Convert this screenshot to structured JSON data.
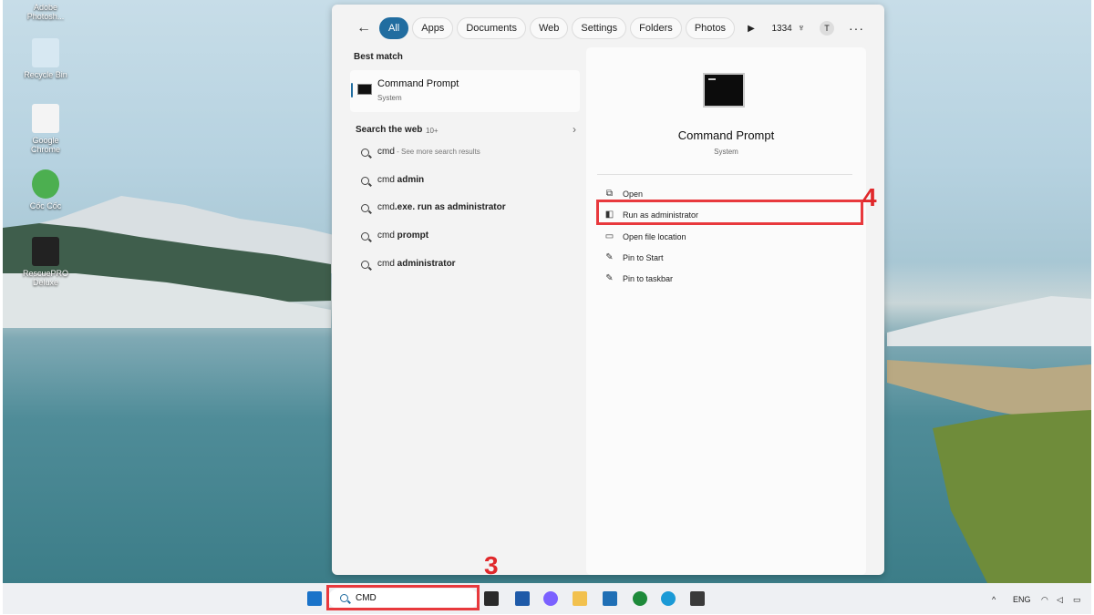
{
  "desktop_icons": [
    {
      "label": "Adobe Photosh...",
      "color": "#1b2a4a"
    },
    {
      "label": "Recycle Bin",
      "color": "#d7e8f2"
    },
    {
      "label": "Google Chrome",
      "color": "#f4f4f4"
    },
    {
      "label": "Cốc Cốc",
      "color": "#4caf50"
    },
    {
      "label": "RescuePRO Deluxe",
      "color": "#222222"
    }
  ],
  "filters": {
    "back": "←",
    "chips": [
      "All",
      "Apps",
      "Documents",
      "Web",
      "Settings",
      "Folders",
      "Photos"
    ],
    "active": "All",
    "play": "▶",
    "points": "1334",
    "avatar": "T",
    "more": "···"
  },
  "best_match": {
    "heading": "Best match",
    "title": "Command Prompt",
    "subtitle": "System"
  },
  "search_web": {
    "heading": "Search the web",
    "count": "10+",
    "chevron": "›",
    "items": [
      {
        "normal": "cmd",
        "bold": "",
        "hint": " - See more search results"
      },
      {
        "normal": "cmd ",
        "bold": "admin",
        "hint": ""
      },
      {
        "normal": "cmd",
        "bold": ".exe. run as administrator",
        "hint": ""
      },
      {
        "normal": "cmd ",
        "bold": "prompt",
        "hint": ""
      },
      {
        "normal": "cmd ",
        "bold": "administrator",
        "hint": ""
      }
    ]
  },
  "details": {
    "title": "Command Prompt",
    "subtitle": "System",
    "actions": [
      {
        "label": "Open",
        "icon": "open-external-icon",
        "glyph": "⧉"
      },
      {
        "label": "Run as administrator",
        "icon": "shield-admin-icon",
        "glyph": "◧"
      },
      {
        "label": "Open file location",
        "icon": "folder-icon",
        "glyph": "▭"
      },
      {
        "label": "Pin to Start",
        "icon": "pin-icon",
        "glyph": "✎"
      },
      {
        "label": "Pin to taskbar",
        "icon": "pin-icon",
        "glyph": "✎"
      }
    ]
  },
  "annotations": {
    "step3": "3",
    "step4": "4",
    "color": "#e8393d"
  },
  "taskbar": {
    "search_value": "CMD",
    "apps": [
      {
        "name": "windows-start-icon",
        "color": "#1a73c9"
      },
      {
        "name": "terminal-icon",
        "color": "#2a2a2a"
      },
      {
        "name": "app-icon",
        "color": "#1e5aa8"
      },
      {
        "name": "copilot-icon",
        "color": "#7b61ff"
      },
      {
        "name": "file-explorer-icon",
        "color": "#f2c14e"
      },
      {
        "name": "store-icon",
        "color": "#1f6fb5"
      },
      {
        "name": "xbox-icon",
        "color": "#1e8a3a"
      },
      {
        "name": "edge-icon",
        "color": "#1b9ad6"
      },
      {
        "name": "app-icon-2",
        "color": "#3a3a3a"
      }
    ],
    "tray_lang": "ENG",
    "tray_chevron": "^"
  }
}
